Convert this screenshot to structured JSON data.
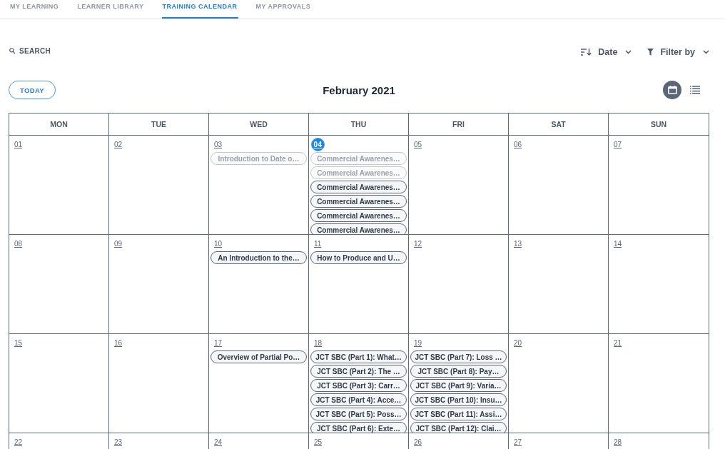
{
  "tabs": [
    {
      "label": "MY LEARNING",
      "selected": false
    },
    {
      "label": "LEARNER LIBRARY",
      "selected": false
    },
    {
      "label": "TRAINING CALENDAR",
      "selected": true
    },
    {
      "label": "MY APPROVALS",
      "selected": false
    }
  ],
  "search": {
    "label": "SEARCH"
  },
  "sort": {
    "label": "Date"
  },
  "filter": {
    "label": "Filter by"
  },
  "today_button": "TODAY",
  "month_title": "February 2021",
  "view_toggle": [
    {
      "kind": "calendar",
      "selected": true
    },
    {
      "kind": "list",
      "selected": false
    }
  ],
  "calendar": {
    "weekdays": [
      "MON",
      "TUE",
      "WED",
      "THU",
      "FRI",
      "SAT",
      "SUN"
    ],
    "weeks": [
      [
        {
          "day": "01",
          "today": false
        },
        {
          "day": "02",
          "today": false
        },
        {
          "day": "03",
          "today": false,
          "events": [
            {
              "title": "Introduction to Date o…",
              "past": true
            }
          ]
        },
        {
          "day": "04",
          "today": true,
          "events": [
            {
              "title": "Commercial Awarenes…",
              "past": true
            },
            {
              "title": "Commercial Awarenes…",
              "past": true
            },
            {
              "title": "Commercial Awarenes…",
              "past": false
            },
            {
              "title": "Commercial Awarenes…",
              "past": false
            },
            {
              "title": "Commercial Awarenes…",
              "past": false
            },
            {
              "title": "Commercial Awarenes…",
              "past": false
            }
          ]
        },
        {
          "day": "05",
          "today": false
        },
        {
          "day": "06",
          "today": false
        },
        {
          "day": "07",
          "today": false
        }
      ],
      [
        {
          "day": "08",
          "today": false
        },
        {
          "day": "09",
          "today": false
        },
        {
          "day": "10",
          "today": false,
          "events": [
            {
              "title": "An Introduction to the…",
              "past": false
            }
          ]
        },
        {
          "day": "11",
          "today": false,
          "events": [
            {
              "title": "How to Produce and U…",
              "past": false
            }
          ]
        },
        {
          "day": "12",
          "today": false
        },
        {
          "day": "13",
          "today": false
        },
        {
          "day": "14",
          "today": false
        }
      ],
      [
        {
          "day": "15",
          "today": false
        },
        {
          "day": "16",
          "today": false
        },
        {
          "day": "17",
          "today": false,
          "events": [
            {
              "title": "Overview of Partial Po…",
              "past": false
            }
          ]
        },
        {
          "day": "18",
          "today": false,
          "events": [
            {
              "title": "JCT SBC (Part 1): What…",
              "past": false
            },
            {
              "title": "JCT SBC (Part 2): The …",
              "past": false
            },
            {
              "title": "JCT SBC (Part 3): Carr…",
              "past": false
            },
            {
              "title": "JCT SBC (Part 4): Acce…",
              "past": false
            },
            {
              "title": "JCT SBC (Part 5): Poss…",
              "past": false
            },
            {
              "title": "JCT SBC (Part 6): Exte…",
              "past": false
            }
          ]
        },
        {
          "day": "19",
          "today": false,
          "events": [
            {
              "title": "JCT SBC (Part 7): Loss …",
              "past": false
            },
            {
              "title": "JCT SBC (Part 8): Pay…",
              "past": false
            },
            {
              "title": "JCT SBC (Part 9): Varia…",
              "past": false
            },
            {
              "title": "JCT SBC (Part 10): Insu…",
              "past": false
            },
            {
              "title": "JCT SBC (Part 11): Assi…",
              "past": false
            },
            {
              "title": "JCT SBC (Part 12): Clai…",
              "past": false
            }
          ]
        },
        {
          "day": "20",
          "today": false
        },
        {
          "day": "21",
          "today": false
        }
      ],
      [
        {
          "day": "22",
          "today": false
        },
        {
          "day": "23",
          "today": false
        },
        {
          "day": "24",
          "today": false
        },
        {
          "day": "25",
          "today": false
        },
        {
          "day": "26",
          "today": false
        },
        {
          "day": "27",
          "today": false
        },
        {
          "day": "28",
          "today": false
        }
      ]
    ]
  }
}
